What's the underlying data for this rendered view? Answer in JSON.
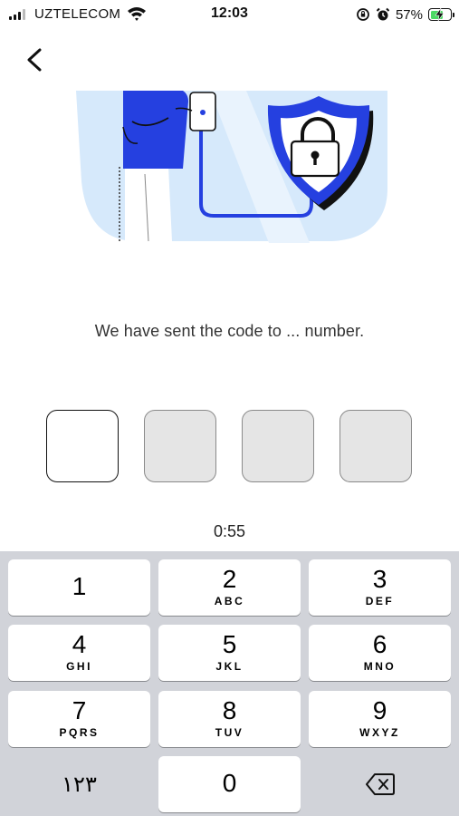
{
  "status_bar": {
    "carrier": "UZTELECOM",
    "time": "12:03",
    "battery_percent": "57%",
    "icons": [
      "signal-icon",
      "wifi-icon",
      "screen-lock-icon",
      "alarm-icon",
      "battery-charging-icon"
    ]
  },
  "header": {
    "back_icon": "chevron-left-icon"
  },
  "illustration": {
    "icon": "shield-lock-illustration",
    "colors": {
      "accent": "#2540e0",
      "background": "#d6e9fb"
    }
  },
  "message": "We have sent the code to ... number.",
  "otp": {
    "length": 4,
    "active_index": 0
  },
  "timer": "0:55",
  "keypad": {
    "keys": [
      {
        "digit": "1",
        "letters": ""
      },
      {
        "digit": "2",
        "letters": "ABC"
      },
      {
        "digit": "3",
        "letters": "DEF"
      },
      {
        "digit": "4",
        "letters": "GHI"
      },
      {
        "digit": "5",
        "letters": "JKL"
      },
      {
        "digit": "6",
        "letters": "MNO"
      },
      {
        "digit": "7",
        "letters": "PQRS"
      },
      {
        "digit": "8",
        "letters": "TUV"
      },
      {
        "digit": "9",
        "letters": "WXYZ"
      }
    ],
    "symbols_key": "١٢٣",
    "zero_key": "0",
    "delete_icon": "backspace-icon"
  }
}
